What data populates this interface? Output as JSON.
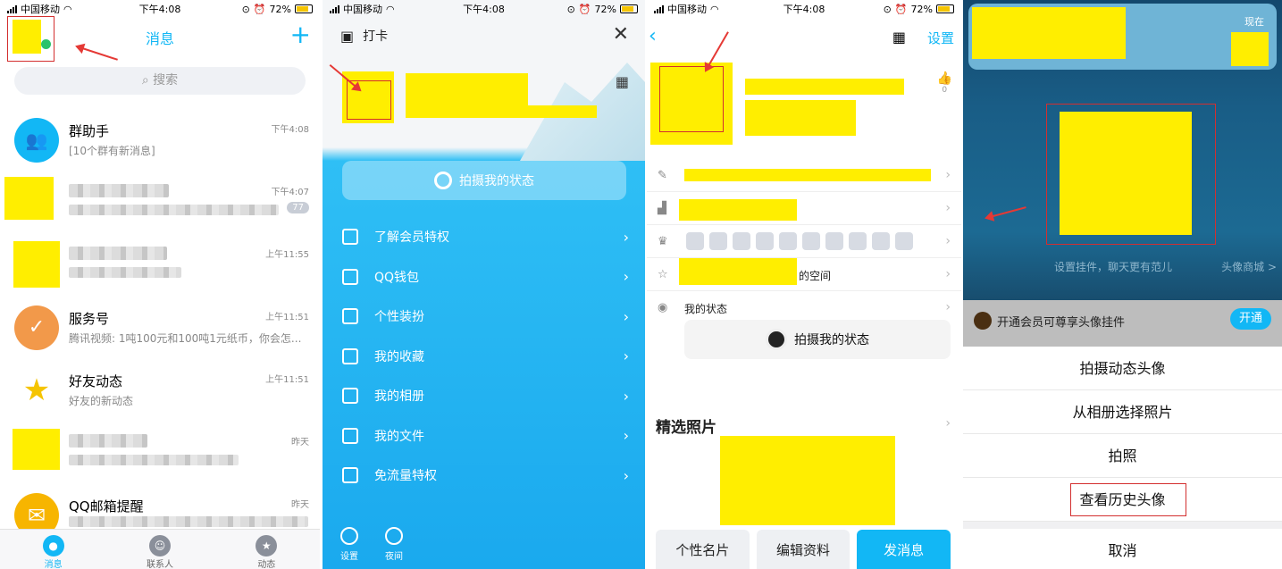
{
  "status_bar": {
    "carrier": "中国移动",
    "time": "下午4:08",
    "battery": "72%"
  },
  "panel1": {
    "title": "消息",
    "add_label": "+",
    "search_placeholder": "搜索",
    "messages": [
      {
        "name": "群助手",
        "preview": "[10个群有新消息]",
        "time": "下午4:08"
      },
      {
        "name": "",
        "preview": "",
        "time": "下午4:07",
        "badge": "77"
      },
      {
        "name": "",
        "preview": "",
        "time": "上午11:55"
      },
      {
        "name": "服务号",
        "preview": "腾讯视频: 1吨100元和100吨1元纸币，你会怎...",
        "time": "上午11:51"
      },
      {
        "name": "好友动态",
        "preview": "好友的新动态",
        "time": "上午11:51"
      },
      {
        "name": "",
        "preview": "",
        "time": "昨天"
      },
      {
        "name": "QQ邮箱提醒",
        "preview": "",
        "time": "昨天"
      }
    ],
    "tabs": [
      "消息",
      "联系人",
      "动态"
    ]
  },
  "panel2": {
    "title": "打卡",
    "shoot_status": "拍摄我的状态",
    "menu": [
      "了解会员特权",
      "QQ钱包",
      "个性装扮",
      "我的收藏",
      "我的相册",
      "我的文件",
      "免流量特权"
    ],
    "bottom": [
      "设置",
      "夜间"
    ]
  },
  "panel3": {
    "settings": "设置",
    "like_count": "0",
    "space_suffix": "的空间",
    "my_status": "我的状态",
    "shoot_status": "拍摄我的状态",
    "photos_title": "精选照片",
    "buttons": [
      "个性名片",
      "编辑资料",
      "发消息"
    ]
  },
  "panel4": {
    "now": "现在",
    "hint": "设置挂件，聊天更有范儿",
    "shop": "头像商城 >",
    "vip_text": "开通会员可尊享头像挂件",
    "vip_button": "开通",
    "options": [
      "拍摄动态头像",
      "从相册选择照片",
      "拍照",
      "查看历史头像"
    ],
    "cancel": "取消"
  },
  "colors": {
    "accent": "#12b7f5",
    "highlight": "#ffee00",
    "annotation": "#e53935"
  }
}
